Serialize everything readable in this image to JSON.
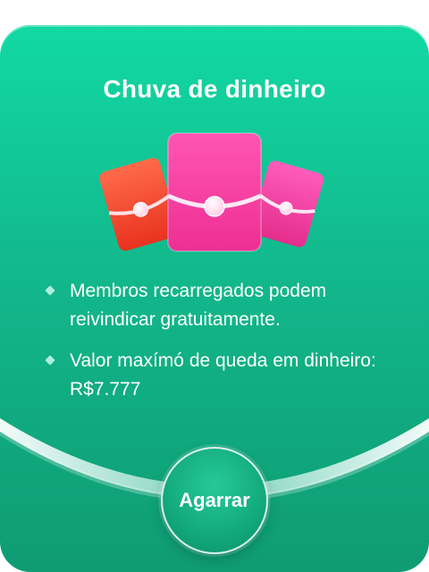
{
  "header": {
    "title": "Chuva de dinheiro"
  },
  "envelopes": [
    {
      "name": "envelope-left",
      "color": "#ff4d3a"
    },
    {
      "name": "envelope-center",
      "color": "#ff3ea5"
    },
    {
      "name": "envelope-right",
      "color": "#ff3ea5"
    }
  ],
  "bullets": [
    {
      "text": "Membros recarregados podem reivindicar gratuitamente."
    },
    {
      "text": "Valor maxímó de queda em dinheiro: R$7.777"
    }
  ],
  "action": {
    "grab_label": "Agarrar"
  },
  "colors": {
    "card_top": "#12d9a3",
    "card_bottom": "#0f9b73",
    "text": "#ffffff"
  }
}
